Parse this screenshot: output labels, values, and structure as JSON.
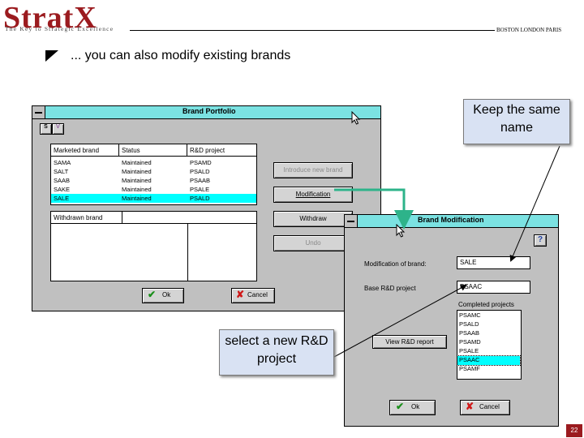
{
  "header": {
    "logo": "StratX",
    "tagline": "The Key to Strategic Excellence",
    "cities": "BOSTON LONDON PARIS",
    "heading": "... you can also modify existing brands"
  },
  "portfolio": {
    "title": "Brand Portfolio",
    "tabs": [
      "S",
      "V"
    ],
    "columns": [
      "Marketed brand",
      "Status",
      "R&D project"
    ],
    "rows": [
      [
        "SAMA",
        "Maintained",
        "PSAMD"
      ],
      [
        "SALT",
        "Maintained",
        "PSALD"
      ],
      [
        "SAAB",
        "Maintained",
        "PSAAB"
      ],
      [
        "SAKE",
        "Maintained",
        "PSALE"
      ],
      [
        "SALE",
        "Maintained",
        "PSALD"
      ]
    ],
    "selected_row": 4,
    "withdrawn_header": "Withdrawn brand",
    "buttons": {
      "introduce": "Introduce new brand",
      "modification": "Modification",
      "withdraw": "Withdraw",
      "undo": "Undo",
      "ok": "Ok",
      "cancel": "Cancel"
    }
  },
  "modification": {
    "title": "Brand Modification",
    "help": "?",
    "mod_label": "Modification of brand:",
    "mod_value": "SALE",
    "base_label": "Base R&D project",
    "base_value": "PSAAC",
    "completed_label": "Completed projects",
    "projects": [
      "PSAMC",
      "PSALD",
      "PSAAB",
      "PSAMD",
      "PSALE",
      "PSAAC",
      "PSAMF"
    ],
    "selected_project": 5,
    "view_button": "View R&D report",
    "ok": "Ok",
    "cancel": "Cancel"
  },
  "callouts": {
    "keep": "Keep the same name",
    "select": "select a new R&D project"
  },
  "page_number": "22",
  "colors": {
    "brand_red": "#9b1b1f",
    "title_cyan": "#7be2e2",
    "selection": "#00ffff",
    "connector_green": "#2db38a",
    "callout_fill": "#d9e2f3"
  }
}
